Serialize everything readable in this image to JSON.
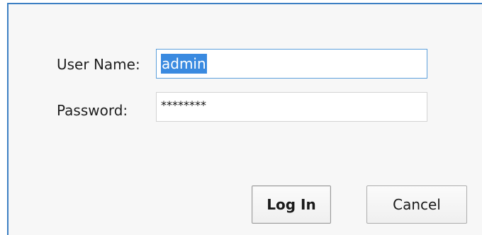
{
  "login_form": {
    "username_label": "User Name:",
    "username_value": "admin",
    "password_label": "Password:",
    "password_mask": "********",
    "login_button": "Log In",
    "cancel_button": "Cancel"
  },
  "colors": {
    "window_border": "#3c7fc3",
    "focus_border": "#5da0db",
    "selection": "#3a8ae0",
    "background": "#f7f7f7"
  }
}
